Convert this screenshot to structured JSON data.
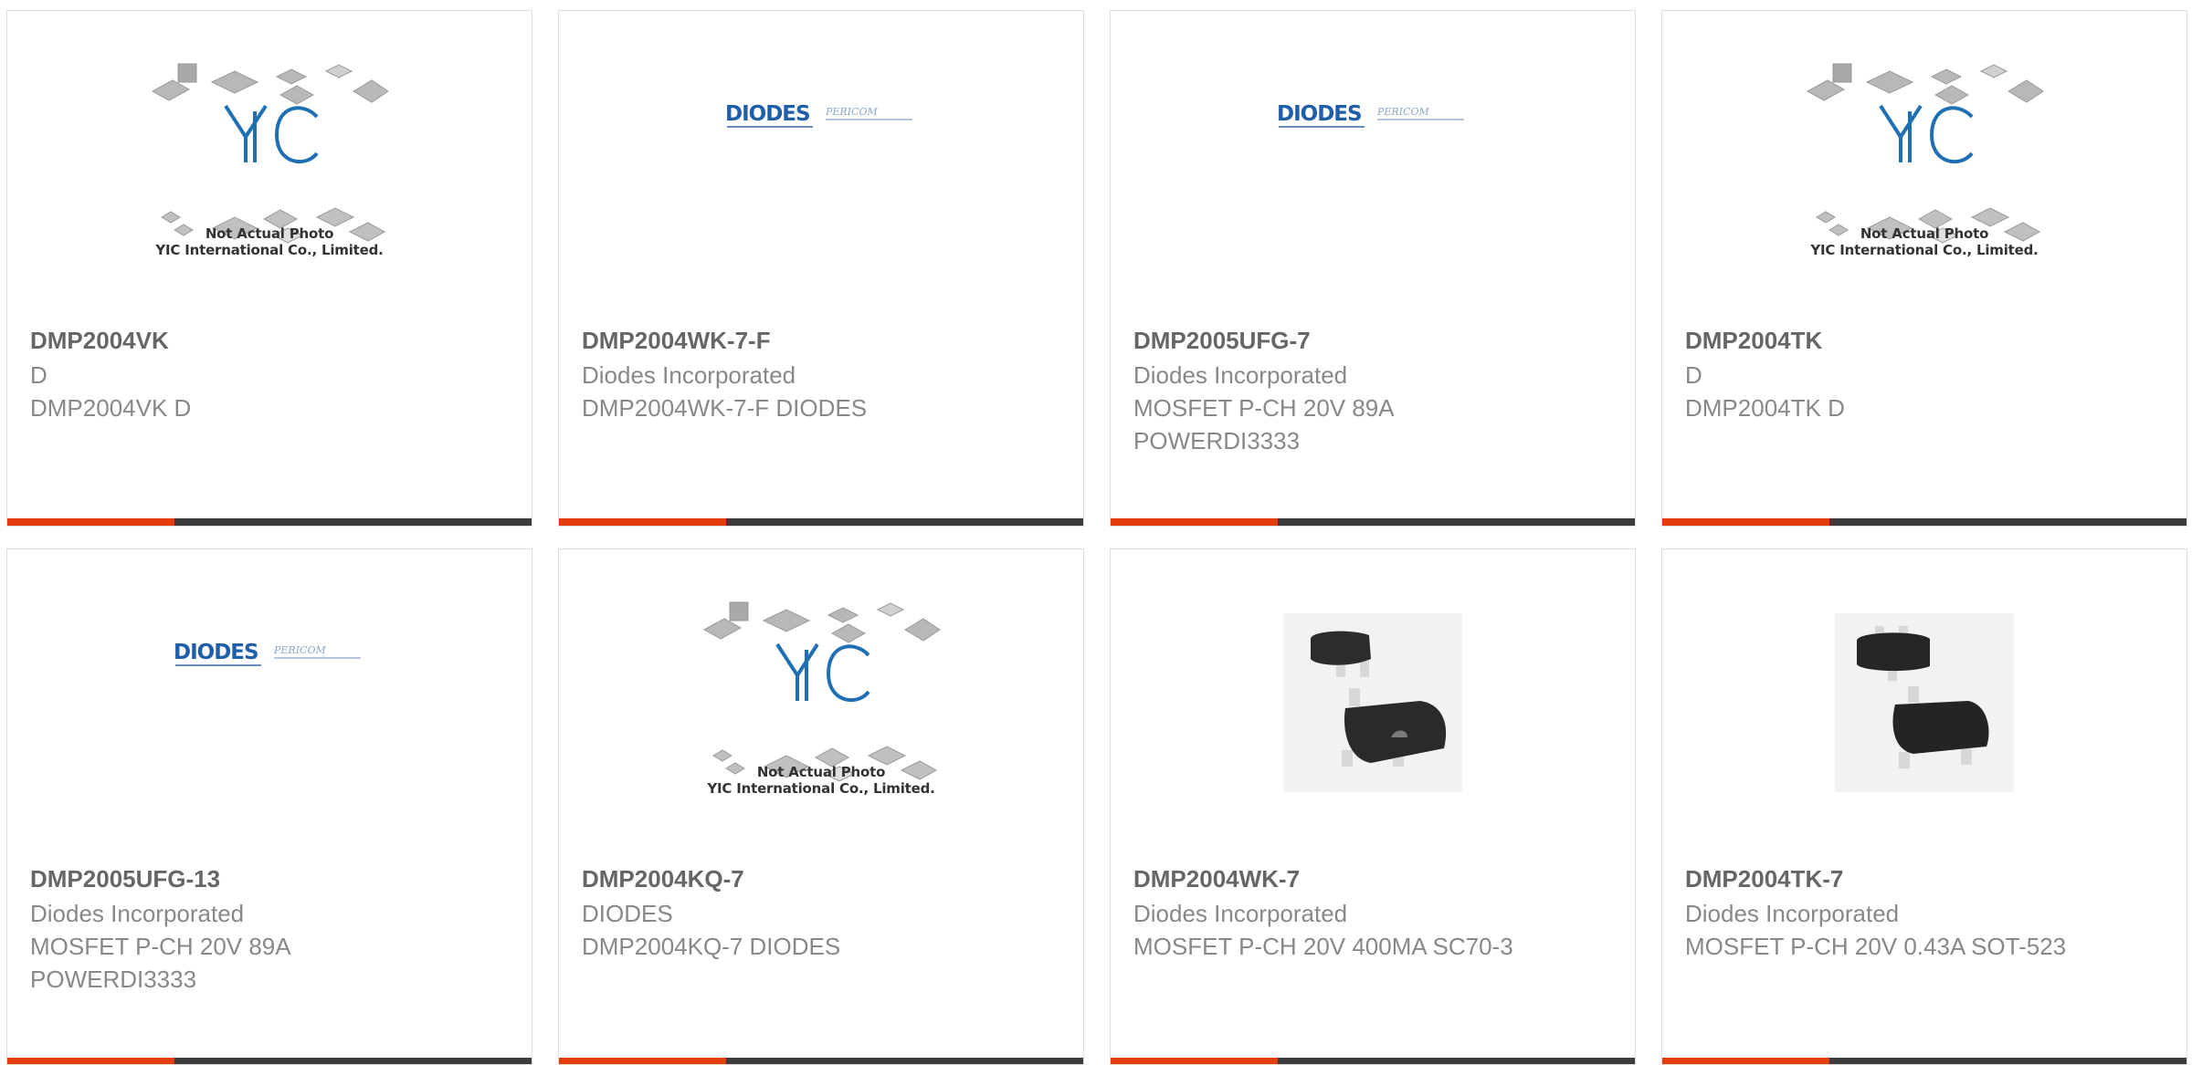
{
  "products": [
    {
      "part": "DMP2004VK",
      "manufacturer": "D",
      "description": "DMP2004VK D",
      "image": "yic-placeholder"
    },
    {
      "part": "DMP2004WK-7-F",
      "manufacturer": "Diodes Incorporated",
      "description": "DMP2004WK-7-F DIODES",
      "image": "diodes-logo"
    },
    {
      "part": "DMP2005UFG-7",
      "manufacturer": "Diodes Incorporated",
      "description": "MOSFET P-CH 20V 89A POWERDI3333",
      "image": "diodes-logo"
    },
    {
      "part": "DMP2004TK",
      "manufacturer": "D",
      "description": "DMP2004TK D",
      "image": "yic-placeholder"
    },
    {
      "part": "DMP2005UFG-13",
      "manufacturer": "Diodes Incorporated",
      "description": "MOSFET P-CH 20V 89A POWERDI3333",
      "image": "diodes-logo"
    },
    {
      "part": "DMP2004KQ-7",
      "manufacturer": "DIODES",
      "description": "DMP2004KQ-7 DIODES",
      "image": "yic-placeholder"
    },
    {
      "part": "DMP2004WK-7",
      "manufacturer": "Diodes Incorporated",
      "description": "MOSFET P-CH 20V 400MA SC70-3",
      "image": "sc70-photo"
    },
    {
      "part": "DMP2004TK-7",
      "manufacturer": "Diodes Incorporated",
      "description": "MOSFET P-CH 20V 0.43A SOT-523",
      "image": "sot523-photo"
    }
  ],
  "placeholder": {
    "brand": "YIC",
    "line1": "Not Actual Photo",
    "line2": "YIC International Co., Limited."
  },
  "logo": {
    "diodes": "DIODES",
    "pericom": "PERICOM"
  },
  "colors": {
    "accent": "#e23d0b",
    "bar": "#3c3c3c",
    "title": "#666666",
    "text": "#888888",
    "border": "#dddddd"
  }
}
